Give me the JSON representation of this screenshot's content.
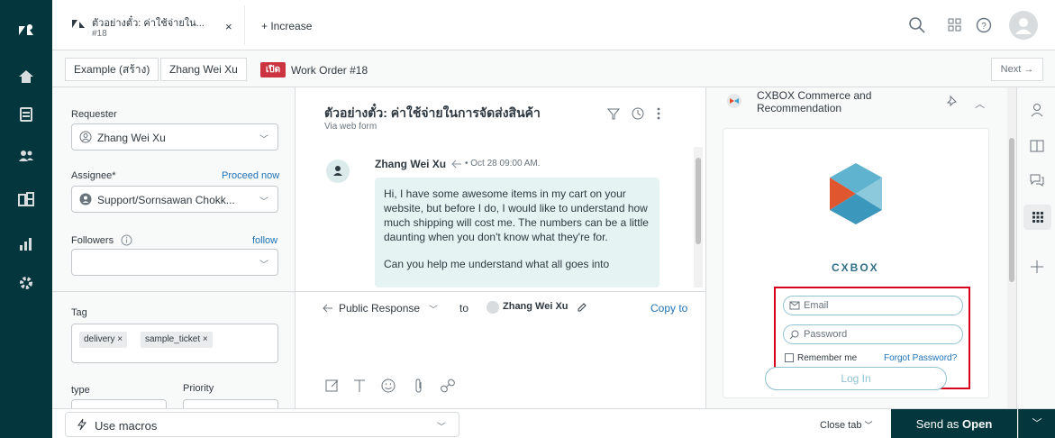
{
  "nav": {
    "icons": [
      "zendesk-logo-icon",
      "home-icon",
      "views-icon",
      "customers-icon",
      "organizations-icon",
      "reporting-icon",
      "admin-gear-icon"
    ]
  },
  "topbar": {
    "tab_title": "ตัวอย่างตั๋ว: ค่าใช้จ่ายใน...",
    "tab_sub": "#18",
    "tab_close": "×",
    "increase_label": "+ Increase",
    "icons": [
      "search-icon",
      "apps-grid-icon",
      "help-icon",
      "user-avatar"
    ]
  },
  "crumbs": {
    "example": "Example (สร้าง)",
    "user": "Zhang Wei Xu",
    "status_badge": "เปิด",
    "work_order": "Work Order #18",
    "next": "Next →"
  },
  "props": {
    "requester_label": "Requester",
    "requester_value": "Zhang Wei Xu",
    "assignee_label": "Assignee*",
    "assignee_link": "Proceed now",
    "assignee_value": "Support/Sornsawan Chokk...",
    "followers_label": "Followers",
    "followers_link": "follow",
    "tag_label": "Tag",
    "tags": [
      "delivery ×",
      "sample_ticket ×"
    ],
    "type_label": "type",
    "priority_label": "Priority"
  },
  "conversation": {
    "title": "ตัวอย่างตั๋ว: ค่าใช้จ่ายในการจัดส่งสินค้า",
    "via": "Via web form",
    "author": "Zhang Wei Xu",
    "meta": "• Oct 28 09:00 AM.",
    "body": "Hi, I have some awesome items in my cart on your website, but before I do, I would like to understand how much shipping will cost me. The numbers can be a little daunting when you don't know what they're for.",
    "body_more": "Can you help me understand what all goes into",
    "reply_type": "Public Response",
    "reply_to": "to",
    "recipient": "Zhang Wei Xu",
    "copy_to": "Copy to"
  },
  "app": {
    "title": "CXBOX Commerce and Recommendation",
    "brand": "CXBOX",
    "email_placeholder": "Email",
    "password_placeholder": "Password",
    "remember": "Remember me",
    "forgot": "Forgot Password?",
    "login": "Log In"
  },
  "bottombar": {
    "macros": "Use macros",
    "close_tab": "Close tab",
    "send_prefix": "Send as ",
    "send_status": "Open"
  },
  "colors": {
    "nav_bg": "#03363d",
    "link": "#1f73b7",
    "badge_red": "#cc3340",
    "highlight_red": "#d6001c"
  }
}
